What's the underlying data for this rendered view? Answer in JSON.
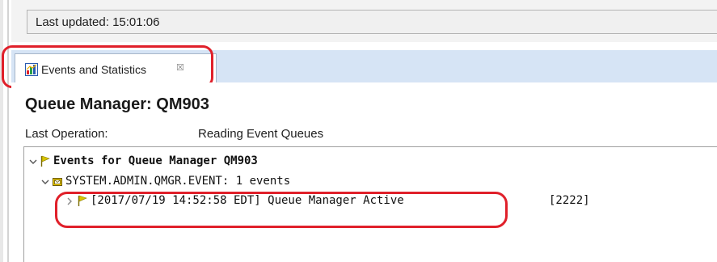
{
  "status": {
    "last_updated": "Last updated: 15:01:06"
  },
  "tab": {
    "label": "Events and Statistics",
    "close_glyph": "☒",
    "icon": "chart-icon"
  },
  "header": {
    "title": "Queue Manager:  QM903",
    "last_operation_label": "Last Operation:",
    "last_operation_value": "Reading Event Queues"
  },
  "tree": {
    "root": {
      "label": "Events for Queue Manager QM903",
      "icon": "flag-icon"
    },
    "queue": {
      "label": "SYSTEM.ADMIN.QMGR.EVENT: 1 events",
      "icon": "message-queue-icon"
    },
    "event": {
      "label": "[2017/07/19 14:52:58 EDT] Queue Manager Active",
      "code": "[2222]",
      "icon": "flag-icon"
    }
  },
  "colors": {
    "annotation": "#e0202a",
    "tabbar": "#d6e4f5",
    "flag": "#d8c400"
  }
}
